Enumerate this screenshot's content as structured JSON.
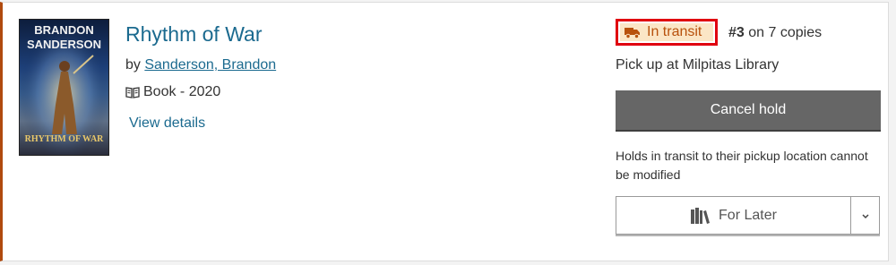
{
  "hold": {
    "title": "Rhythm of War",
    "by_label": "by",
    "author": "Sanderson, Brandon",
    "format": "Book - 2020",
    "view_details": "View details",
    "cover": {
      "author_line1": "BRANDON",
      "author_line2": "SANDERSON",
      "title_line": "RHYTHM OF WAR"
    },
    "status": "In transit",
    "queue_position": "#3",
    "copies_text": "on 7 copies",
    "pickup": "Pick up at Milpitas Library",
    "cancel_label": "Cancel hold",
    "note": "Holds in transit to their pickup location cannot be modified",
    "shelf_label": "For Later",
    "icons": {
      "status": "truck-icon",
      "format": "book-icon",
      "shelf": "books-icon",
      "toggle": "chevron-down-icon"
    },
    "colors": {
      "link": "#1b6a8f",
      "status_text": "#b8510c",
      "status_bg": "#fbe6c6",
      "highlight_border": "#e0000f",
      "button_bg": "#666666",
      "card_accent": "#b04a0e"
    }
  }
}
